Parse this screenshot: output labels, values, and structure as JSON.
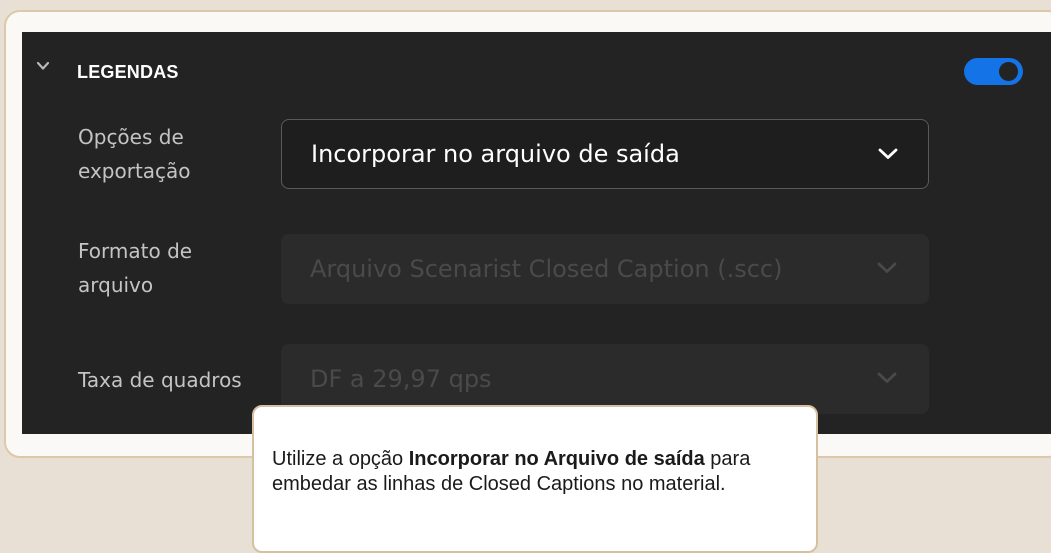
{
  "colors": {
    "background": "#e8e0d4",
    "panel": "#232323",
    "toggle_on": "#1473e6",
    "card_border": "#dcc9ab"
  },
  "section": {
    "title": "LEGENDAS",
    "chevron_icon": "chevron-down-icon",
    "toggle_state": "on"
  },
  "fields": [
    {
      "label_line1": "Opções de",
      "label_line2": "exportação",
      "value": "Incorporar no arquivo de saída",
      "state": "enabled"
    },
    {
      "label_line1": "Formato de",
      "label_line2": "arquivo",
      "value": "Arquivo Scenarist Closed Caption (.scc)",
      "state": "disabled"
    },
    {
      "label_line1": "Taxa de quadros",
      "value": "DF a 29,97 qps",
      "state": "disabled"
    }
  ],
  "tooltip": {
    "text_before": "Utilize a opção ",
    "text_bold": "Incorporar no Arquivo de saída",
    "text_after": " para embedar as linhas de Closed Captions no material."
  }
}
